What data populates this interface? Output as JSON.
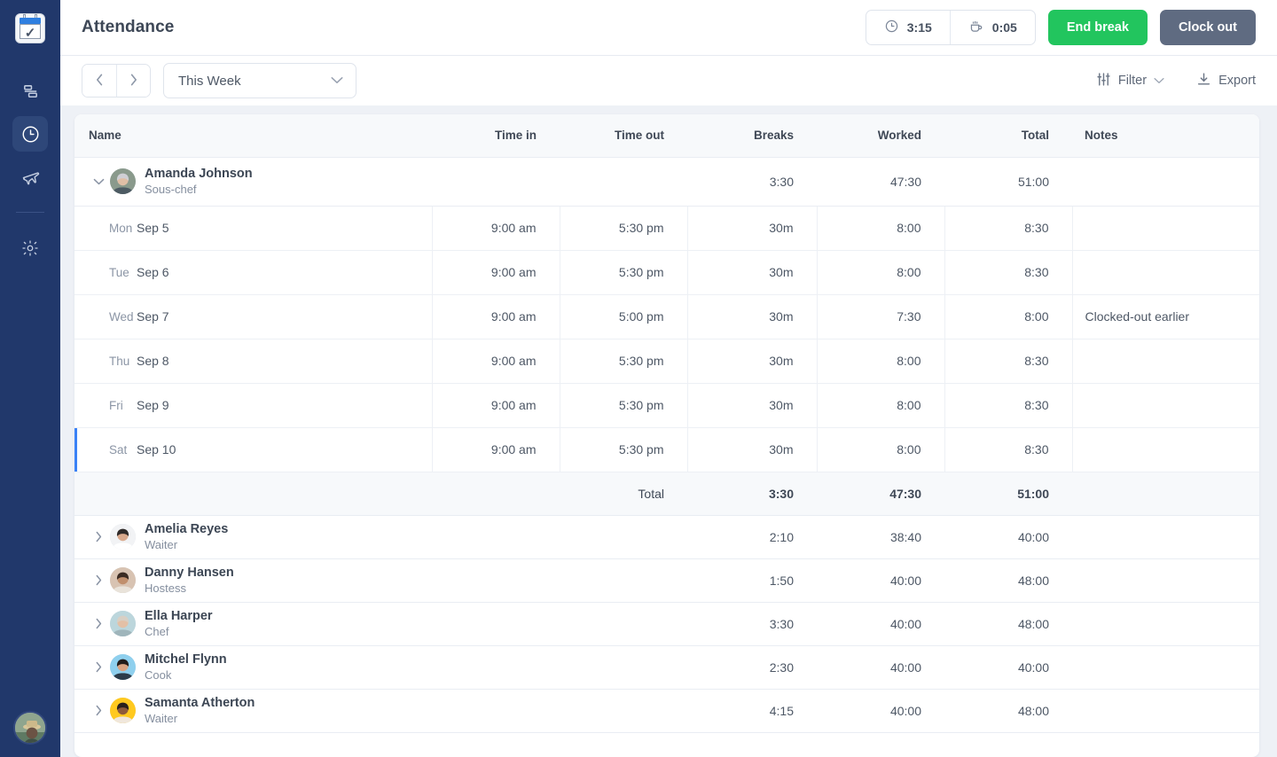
{
  "brand": {
    "accent": "#3b82f6",
    "green": "#22c55e",
    "slate": "#5f6b81",
    "sidebar_bg": "#21386b"
  },
  "sidebar": {
    "logo_name": "calendar-check-logo",
    "items": [
      {
        "label": "Schedule",
        "icon": "gantt-bars-icon",
        "active": false
      },
      {
        "label": "Attendance",
        "icon": "clock-icon",
        "active": true
      },
      {
        "label": "Time off",
        "icon": "airplane-icon",
        "active": false
      },
      {
        "label": "Settings",
        "icon": "gear-icon",
        "active": false
      }
    ],
    "user_avatar": "user-avatar"
  },
  "header": {
    "title": "Attendance",
    "timers": [
      {
        "icon": "clock-icon",
        "value": "3:15"
      },
      {
        "icon": "coffee-cup-icon",
        "value": "0:05"
      }
    ],
    "end_break_label": "End break",
    "clock_out_label": "Clock out"
  },
  "toolbar": {
    "prev_label": "‹",
    "next_label": "›",
    "range_value": "This Week",
    "filter_label": "Filter",
    "export_label": "Export"
  },
  "table": {
    "columns": [
      "Name",
      "Time in",
      "Time out",
      "Breaks",
      "Worked",
      "Total",
      "Notes"
    ],
    "total_row_label": "Total",
    "expanded_employee": {
      "name": "Amanda Johnson",
      "role": "Sous-chef",
      "breaks": "3:30",
      "worked": "47:30",
      "total": "51:00",
      "notes": "",
      "days": [
        {
          "dow": "Mon",
          "date": "Sep 5",
          "time_in": "9:00 am",
          "time_out": "5:30 pm",
          "breaks": "30m",
          "worked": "8:00",
          "total": "8:30",
          "notes": "",
          "highlight": false
        },
        {
          "dow": "Tue",
          "date": "Sep 6",
          "time_in": "9:00 am",
          "time_out": "5:30 pm",
          "breaks": "30m",
          "worked": "8:00",
          "total": "8:30",
          "notes": "",
          "highlight": false
        },
        {
          "dow": "Wed",
          "date": "Sep 7",
          "time_in": "9:00 am",
          "time_out": "5:00 pm",
          "breaks": "30m",
          "worked": "7:30",
          "total": "8:00",
          "notes": "Clocked-out earlier",
          "highlight": false
        },
        {
          "dow": "Thu",
          "date": "Sep 8",
          "time_in": "9:00 am",
          "time_out": "5:30 pm",
          "breaks": "30m",
          "worked": "8:00",
          "total": "8:30",
          "notes": "",
          "highlight": false
        },
        {
          "dow": "Fri",
          "date": "Sep 9",
          "time_in": "9:00 am",
          "time_out": "5:30 pm",
          "breaks": "30m",
          "worked": "8:00",
          "total": "8:30",
          "notes": "",
          "highlight": false
        },
        {
          "dow": "Sat",
          "date": "Sep 10",
          "time_in": "9:00 am",
          "time_out": "5:30 pm",
          "breaks": "30m",
          "worked": "8:00",
          "total": "8:30",
          "notes": "",
          "highlight": true
        }
      ],
      "totals": {
        "breaks": "3:30",
        "worked": "47:30",
        "total": "51:00"
      }
    },
    "collapsed_employees": [
      {
        "name": "Amelia Reyes",
        "role": "Waiter",
        "breaks": "2:10",
        "worked": "38:40",
        "total": "40:00",
        "notes": ""
      },
      {
        "name": "Danny Hansen",
        "role": "Hostess",
        "breaks": "1:50",
        "worked": "40:00",
        "total": "48:00",
        "notes": ""
      },
      {
        "name": "Ella Harper",
        "role": "Chef",
        "breaks": "3:30",
        "worked": "40:00",
        "total": "48:00",
        "notes": ""
      },
      {
        "name": "Mitchel Flynn",
        "role": "Cook",
        "breaks": "2:30",
        "worked": "40:00",
        "total": "40:00",
        "notes": ""
      },
      {
        "name": "Samanta Atherton",
        "role": "Waiter",
        "breaks": "4:15",
        "worked": "40:00",
        "total": "48:00",
        "notes": ""
      }
    ]
  }
}
